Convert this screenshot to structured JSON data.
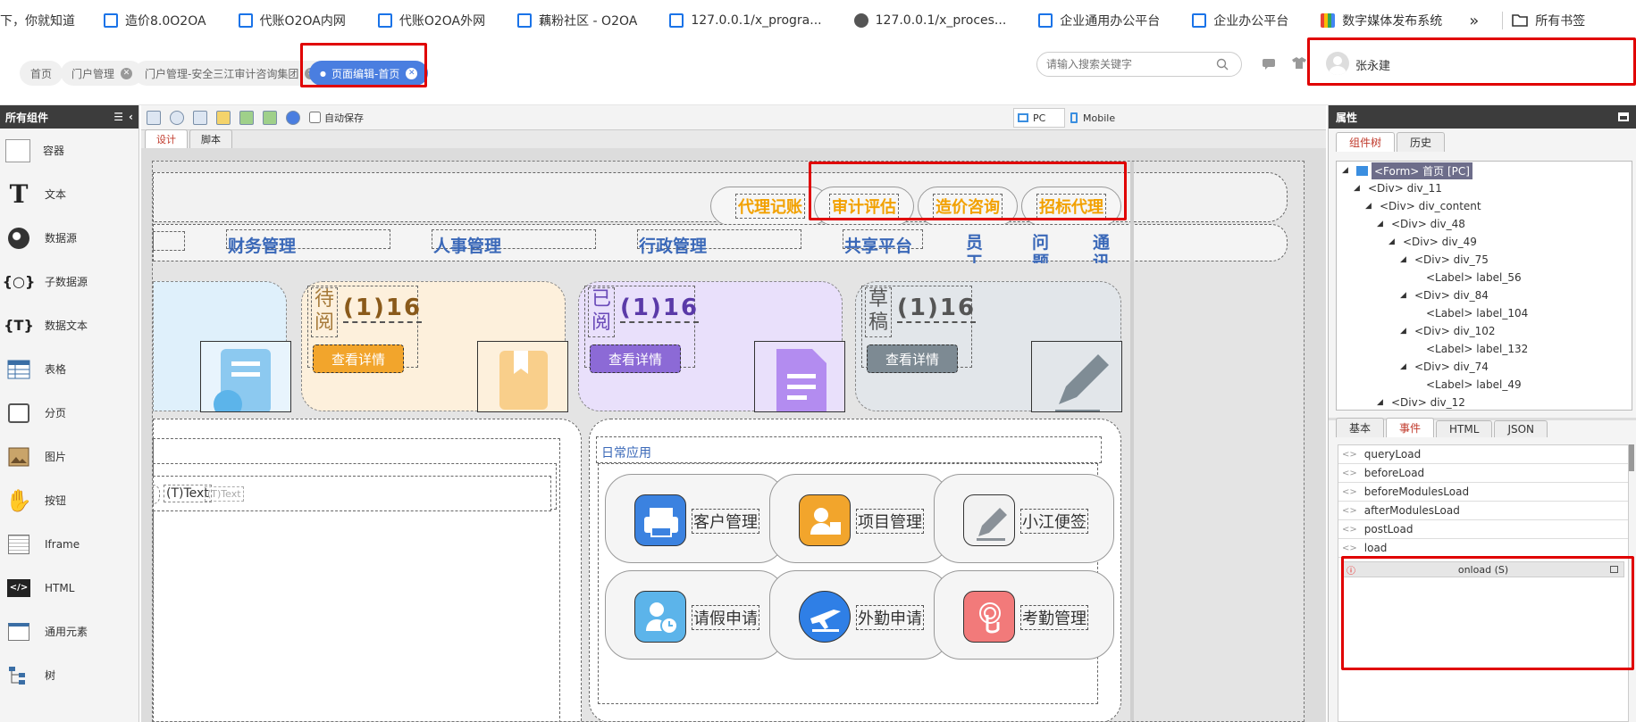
{
  "bookmarks": {
    "items": [
      "下，你就知道",
      "造价8.0O2OA",
      "代账O2OA内网",
      "代账O2OA外网",
      "藕粉社区 - O2OA",
      "127.0.0.1/x_progra...",
      "127.0.0.1/x_proces...",
      "企业通用办公平台",
      "企业办公平台",
      "数字媒体发布系统"
    ],
    "more": "»",
    "all_label": "所有书签"
  },
  "tabs": {
    "items": [
      "首页",
      "门户管理",
      "门户管理-安全三江审计咨询集团",
      "页面编辑-首页"
    ],
    "active_index": 3,
    "search_placeholder": "请输入搜索关键字",
    "user_name": "张永建"
  },
  "left_panel": {
    "title": "所有组件",
    "components": [
      "容器",
      "文本",
      "数据源",
      "子数据源",
      "数据文本",
      "表格",
      "分页",
      "图片",
      "按钮",
      "Iframe",
      "HTML",
      "通用元素",
      "树"
    ]
  },
  "editor": {
    "autosave_label": "自动保存",
    "view_pc": "PC",
    "view_mobile": "Mobile",
    "tab_design": "设计",
    "tab_script": "脚本"
  },
  "canvas": {
    "top_links": [
      "代理记账",
      "审计评估",
      "造价咨询",
      "招标代理"
    ],
    "menu": [
      "财务管理",
      "人事管理",
      "行政管理",
      "共享平台",
      "员工",
      "问题",
      "通讯"
    ],
    "menu_sub": "",
    "cards": [
      {
        "label_a": "待",
        "label_b": "阅",
        "count": "(1)16",
        "button": "查看详情",
        "color": "#f2a52c"
      },
      {
        "label_a": "已",
        "label_b": "阅",
        "count": "(1)16",
        "button": "查看详情",
        "color": "#8c6ad6"
      },
      {
        "label_a": "草",
        "label_b": "稿",
        "count": "(1)16",
        "button": "查看详情",
        "color": "#7d8a93"
      }
    ],
    "text_field": "(T)Text",
    "text_field_small": "(T)Text",
    "daily_apps_title": "日常应用",
    "apps": [
      "客户管理",
      "项目管理",
      "小江便签",
      "请假申请",
      "外勤申请",
      "考勤管理"
    ]
  },
  "right_panel": {
    "title": "属性",
    "tabs": [
      "组件树",
      "历史"
    ],
    "tree": [
      {
        "depth": 0,
        "text": "<Form> 首页 [PC]",
        "selected": true
      },
      {
        "depth": 1,
        "text": "<Div> div_11"
      },
      {
        "depth": 2,
        "text": "<Div> div_content"
      },
      {
        "depth": 3,
        "text": "<Div> div_48"
      },
      {
        "depth": 4,
        "text": "<Div> div_49"
      },
      {
        "depth": 5,
        "text": "<Div> div_75"
      },
      {
        "depth": 6,
        "text": "<Label> label_56"
      },
      {
        "depth": 5,
        "text": "<Div> div_84"
      },
      {
        "depth": 6,
        "text": "<Label> label_104"
      },
      {
        "depth": 5,
        "text": "<Div> div_102"
      },
      {
        "depth": 6,
        "text": "<Label> label_132"
      },
      {
        "depth": 5,
        "text": "<Div> div_74"
      },
      {
        "depth": 6,
        "text": "<Label> label_49"
      },
      {
        "depth": 3,
        "text": "<Div> div_12"
      }
    ],
    "prop_tabs": [
      "基本",
      "事件",
      "HTML",
      "JSON"
    ],
    "active_prop_tab": 1,
    "events": [
      "queryLoad",
      "beforeLoad",
      "beforeModulesLoad",
      "afterModulesLoad",
      "postLoad",
      "load"
    ],
    "script_title": "onload (S)"
  }
}
